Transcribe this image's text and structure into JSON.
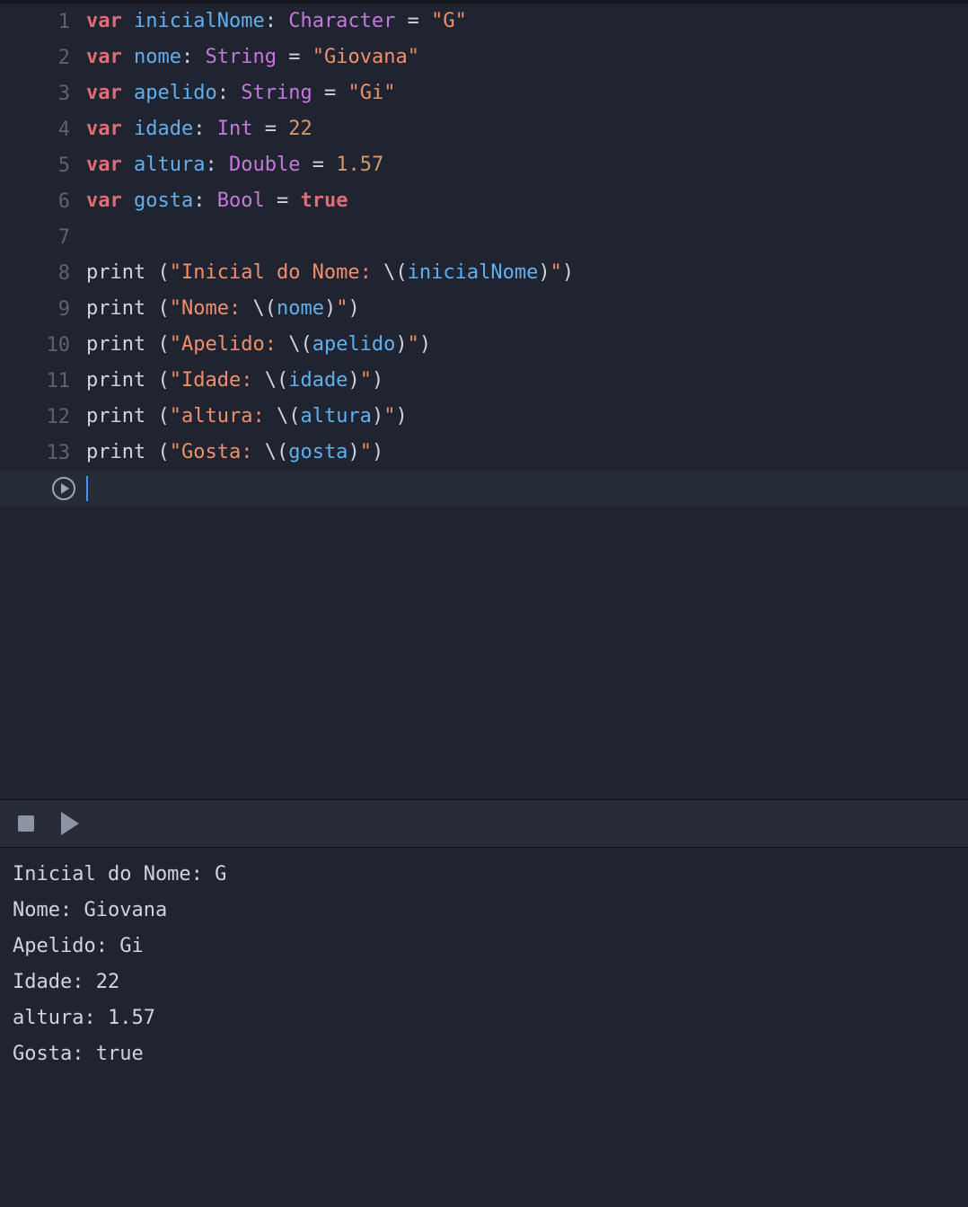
{
  "editor": {
    "lines": [
      {
        "num": "1"
      },
      {
        "num": "2"
      },
      {
        "num": "3"
      },
      {
        "num": "4"
      },
      {
        "num": "5"
      },
      {
        "num": "6"
      },
      {
        "num": "7"
      },
      {
        "num": "8"
      },
      {
        "num": "9"
      },
      {
        "num": "10"
      },
      {
        "num": "11"
      },
      {
        "num": "12"
      },
      {
        "num": "13"
      }
    ],
    "tokens": {
      "kw_var": "var",
      "sp": " ",
      "colon": ":",
      "eq": "=",
      "lpar": "(",
      "rpar": ")",
      "q": "\"",
      "esc_open": "\\(",
      "esc_close": ")",
      "v_inicialNome": "inicialNome",
      "v_nome": "nome",
      "v_apelido": "apelido",
      "v_idade": "idade",
      "v_altura": "altura",
      "v_gosta": "gosta",
      "t_Character": "Character",
      "t_String": "String",
      "t_Int": "Int",
      "t_Double": "Double",
      "t_Bool": "Bool",
      "s_G": "G",
      "s_Giovana": "Giovana",
      "s_Gi": "Gi",
      "n_22": "22",
      "n_157": "1.57",
      "b_true": "true",
      "fn_print": "print",
      "lbl_inicial": "Inicial do Nome: ",
      "lbl_nome": "Nome: ",
      "lbl_apelido": "Apelido: ",
      "lbl_idade": "Idade: ",
      "lbl_altura": "altura: ",
      "lbl_gosta": "Gosta: "
    }
  },
  "console": {
    "out": [
      "Inicial do Nome: G",
      "Nome: Giovana",
      "Apelido: Gi",
      "Idade: 22",
      "altura: 1.57",
      "Gosta: true"
    ]
  }
}
